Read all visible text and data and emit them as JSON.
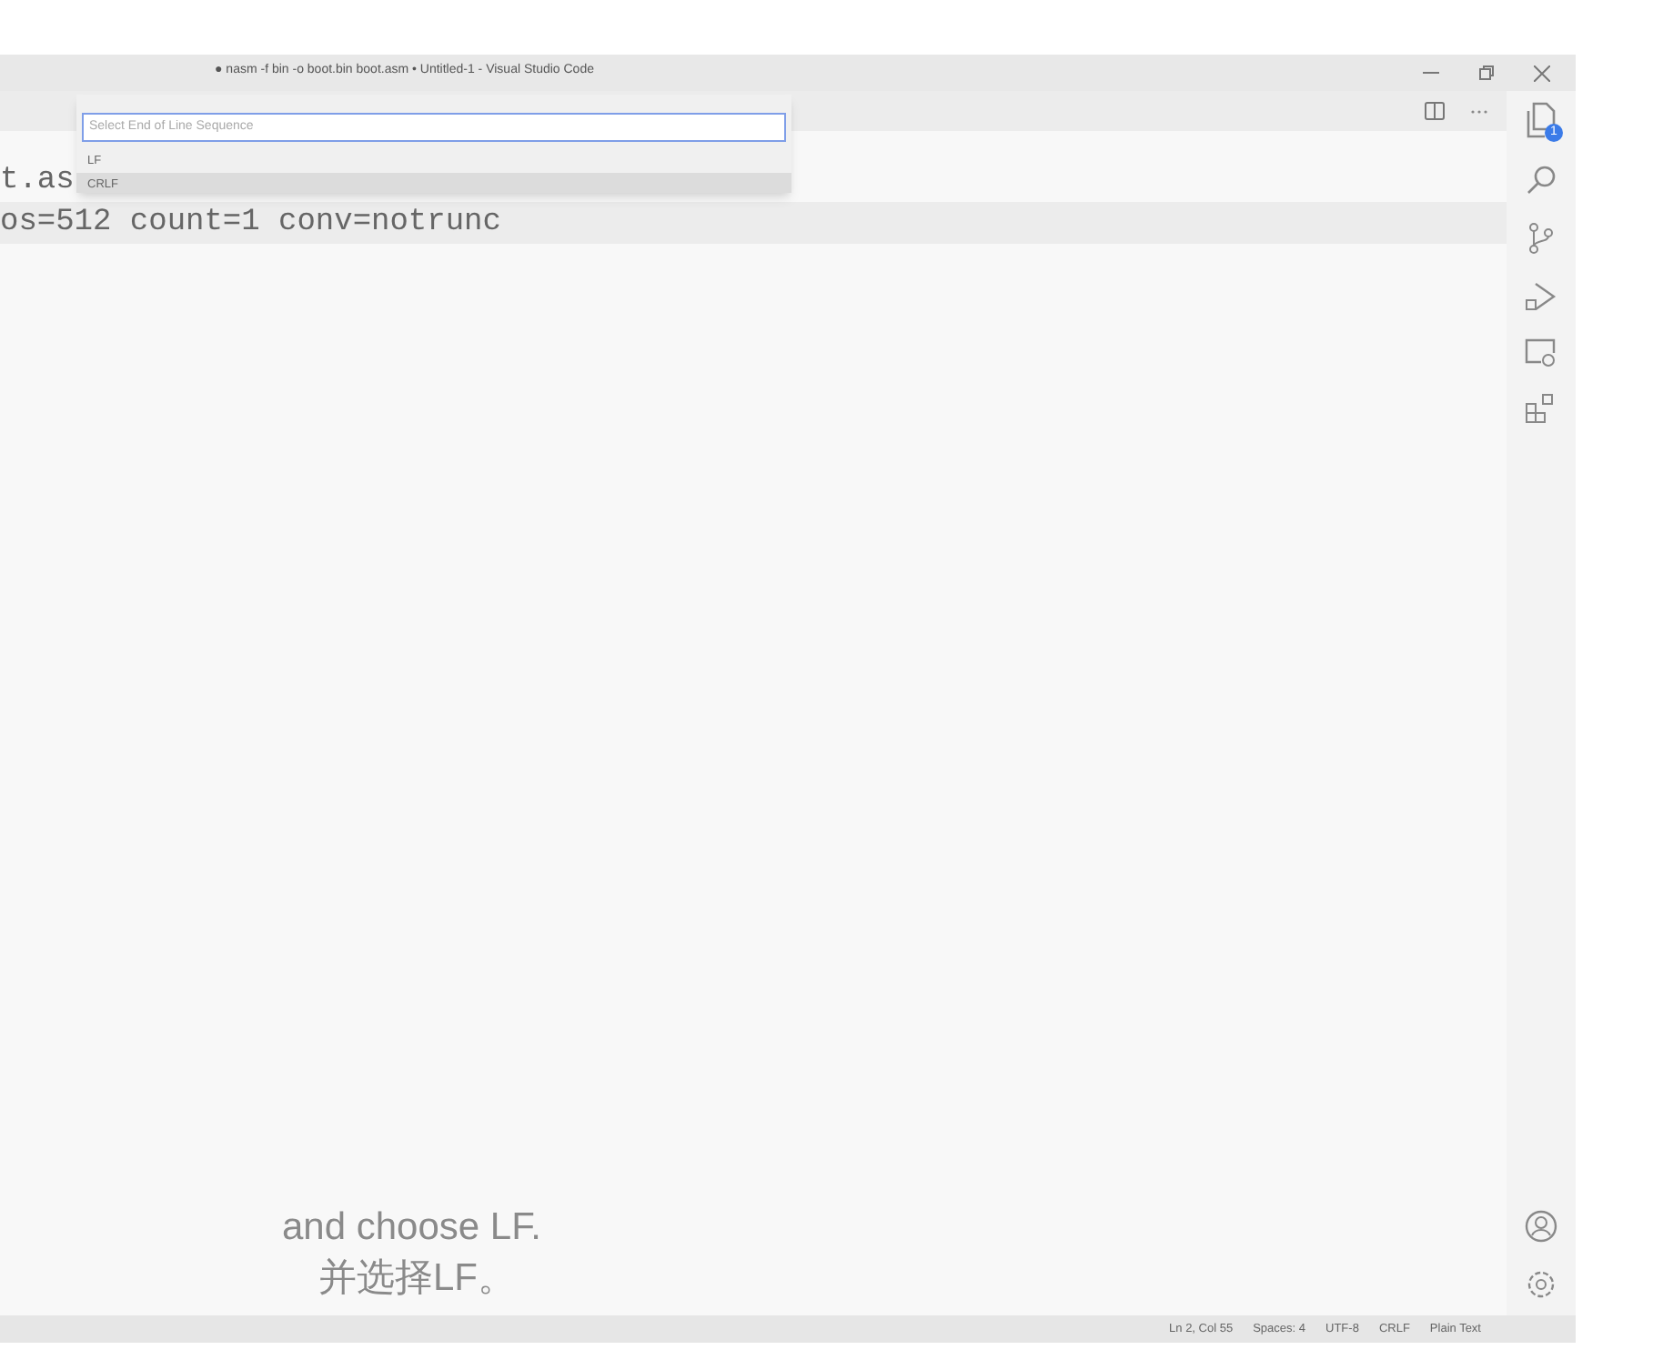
{
  "window": {
    "title": "● nasm -f bin -o boot.bin boot.asm • Untitled-1 - Visual Studio Code"
  },
  "editor": {
    "lines": [
      {
        "text": "t.as",
        "current": false
      },
      {
        "text": "os=512 count=1 conv=notrunc",
        "current": true
      }
    ]
  },
  "quick_pick": {
    "placeholder": "Select End of Line Sequence",
    "items": [
      {
        "label": "LF",
        "selected": false
      },
      {
        "label": "CRLF",
        "selected": true
      }
    ]
  },
  "activity_bar": {
    "explorer_badge": "1"
  },
  "status_bar": {
    "items": [
      "Ln 2, Col 55",
      "Spaces: 4",
      "UTF-8",
      "CRLF",
      "Plain Text"
    ]
  },
  "captions": [
    "and choose LF.",
    "并选择LF。"
  ]
}
